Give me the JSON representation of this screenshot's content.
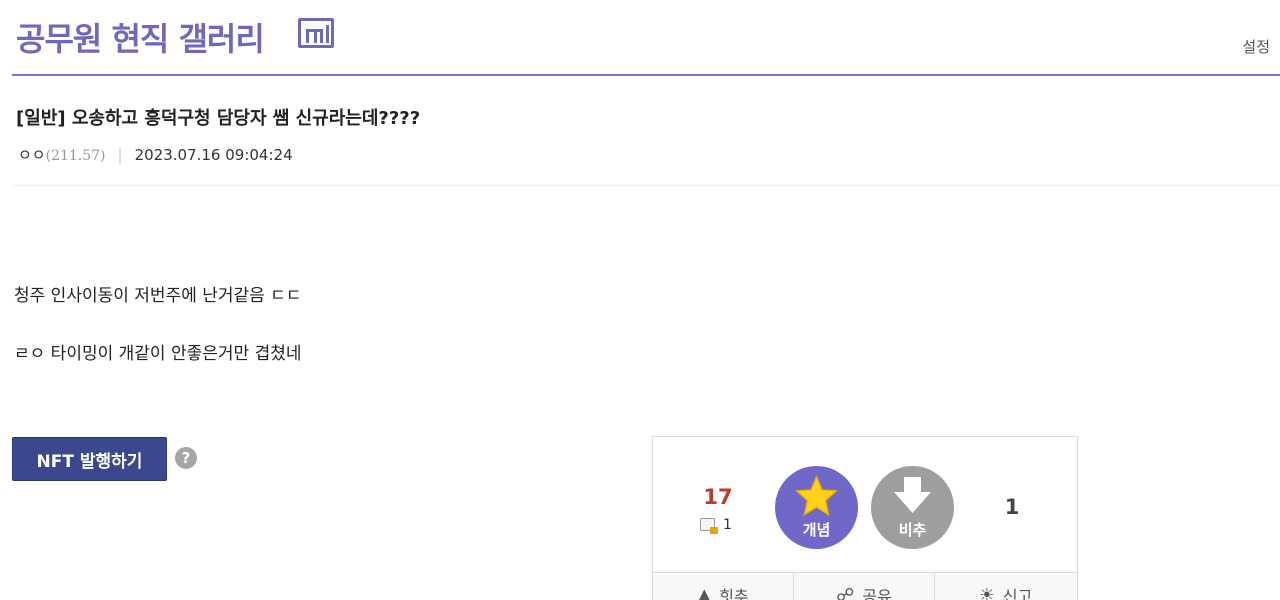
{
  "header": {
    "gallery_title": "공무원 현직 갤러리",
    "badge": "mi",
    "settings_label": "설정"
  },
  "post": {
    "title": "[일반] 오송하고 흥덕구청 담당자 쌤 신규라는데????",
    "author": "ㅇㅇ",
    "ip": "(211.57)",
    "datetime": "2023.07.16 09:04:24",
    "body": [
      "청주 인사이동이 저번주에 난거같음 ㄷㄷ",
      "ㄹㅇ 타이밍이 개같이 안좋은거만 겹쳤네"
    ]
  },
  "nft": {
    "button_label": "NFT 발행하기",
    "help_icon": "?"
  },
  "vote": {
    "up_count": "17",
    "fix_count": "1",
    "up_label": "개념",
    "down_label": "비추",
    "down_count": "1",
    "up_color": "#6f68c9",
    "down_color": "#9e9e9e",
    "actions": [
      {
        "label": "힛추",
        "icon": "thumbs-up-icon"
      },
      {
        "label": "공유",
        "icon": "share-icon"
      },
      {
        "label": "신고",
        "icon": "siren-icon"
      }
    ]
  },
  "colors": {
    "brand": "#6f67c0",
    "nft_button": "#3b4890"
  }
}
